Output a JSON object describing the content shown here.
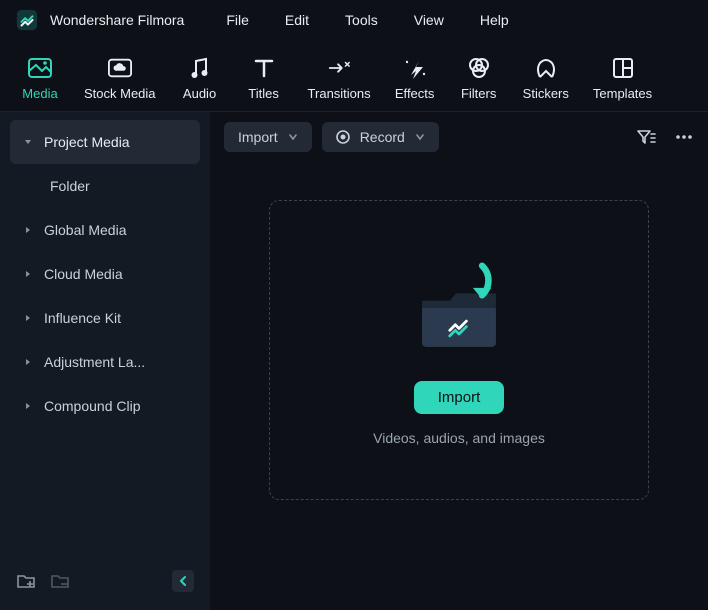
{
  "app_title": "Wondershare Filmora",
  "menubar": [
    "File",
    "Edit",
    "Tools",
    "View",
    "Help"
  ],
  "tabs": [
    {
      "label": "Media",
      "icon": "media",
      "active": true
    },
    {
      "label": "Stock Media",
      "icon": "cloud",
      "active": false
    },
    {
      "label": "Audio",
      "icon": "audio",
      "active": false
    },
    {
      "label": "Titles",
      "icon": "titles",
      "active": false
    },
    {
      "label": "Transitions",
      "icon": "transitions",
      "active": false
    },
    {
      "label": "Effects",
      "icon": "effects",
      "active": false
    },
    {
      "label": "Filters",
      "icon": "filters",
      "active": false
    },
    {
      "label": "Stickers",
      "icon": "stickers",
      "active": false
    },
    {
      "label": "Templates",
      "icon": "templates",
      "active": false
    }
  ],
  "sidebar": {
    "items": [
      {
        "label": "Project Media",
        "expanded": true,
        "selected": true
      },
      {
        "label": "Folder",
        "sub": true
      },
      {
        "label": "Global Media",
        "expanded": false
      },
      {
        "label": "Cloud Media",
        "expanded": false
      },
      {
        "label": "Influence Kit",
        "expanded": false
      },
      {
        "label": "Adjustment La...",
        "expanded": false
      },
      {
        "label": "Compound Clip",
        "expanded": false
      }
    ]
  },
  "toolbar": {
    "import_label": "Import",
    "record_label": "Record"
  },
  "drop": {
    "button": "Import",
    "caption": "Videos, audios, and images"
  },
  "colors": {
    "accent": "#2fd6b9"
  }
}
